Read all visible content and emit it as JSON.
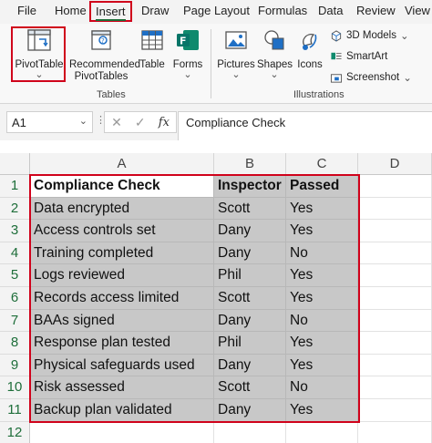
{
  "menu": {
    "tabs": [
      "File",
      "Home",
      "Insert",
      "Draw",
      "Page Layout",
      "Formulas",
      "Data",
      "Review",
      "View"
    ],
    "active": "Insert"
  },
  "ribbon": {
    "pivottable": "PivotTable",
    "pivottable_chevron": "⌄",
    "recommended_line1": "Recommended",
    "recommended_line2": "PivotTables",
    "table": "Table",
    "forms": "Forms",
    "forms_chevron": "⌄",
    "tables_group": "Tables",
    "pictures": "Pictures",
    "shapes": "Shapes",
    "icons": "Icons",
    "pictures_chevron": "⌄",
    "shapes_chevron": "⌄",
    "models_3d": "3D Models",
    "smartart": "SmartArt",
    "screenshot": "Screenshot",
    "illustrations_group": "Illustrations",
    "models_chevron": "⌄",
    "screenshot_chevron": "⌄"
  },
  "formula_bar": {
    "name_box": "A1",
    "name_box_chevron": "⌄",
    "dots": "⋮",
    "cancel": "✕",
    "enter": "✓",
    "fx": "fx",
    "formula": "Compliance Check"
  },
  "sheet": {
    "columns": [
      "A",
      "B",
      "C",
      "D"
    ],
    "rows": [
      "1",
      "2",
      "3",
      "4",
      "5",
      "6",
      "7",
      "8",
      "9",
      "10",
      "11",
      "12"
    ],
    "headers": [
      "Compliance Check",
      "Inspector",
      "Passed"
    ],
    "data": [
      [
        "Data encrypted",
        "Scott",
        "Yes"
      ],
      [
        "Access controls set",
        "Dany",
        "Yes"
      ],
      [
        "Training completed",
        "Dany",
        "No"
      ],
      [
        "Logs reviewed",
        "Phil",
        "Yes"
      ],
      [
        "Records access limited",
        "Scott",
        "Yes"
      ],
      [
        "BAAs signed",
        "Dany",
        "No"
      ],
      [
        "Response plan tested",
        "Phil",
        "Yes"
      ],
      [
        "Physical safeguards used",
        "Dany",
        "Yes"
      ],
      [
        "Risk assessed",
        "Scott",
        "No"
      ],
      [
        "Backup plan validated",
        "Dany",
        "Yes"
      ]
    ]
  },
  "colors": {
    "accent_red": "#d0021b",
    "excel_green": "#1e6e3a",
    "selection_gray": "#c8c8c8"
  }
}
